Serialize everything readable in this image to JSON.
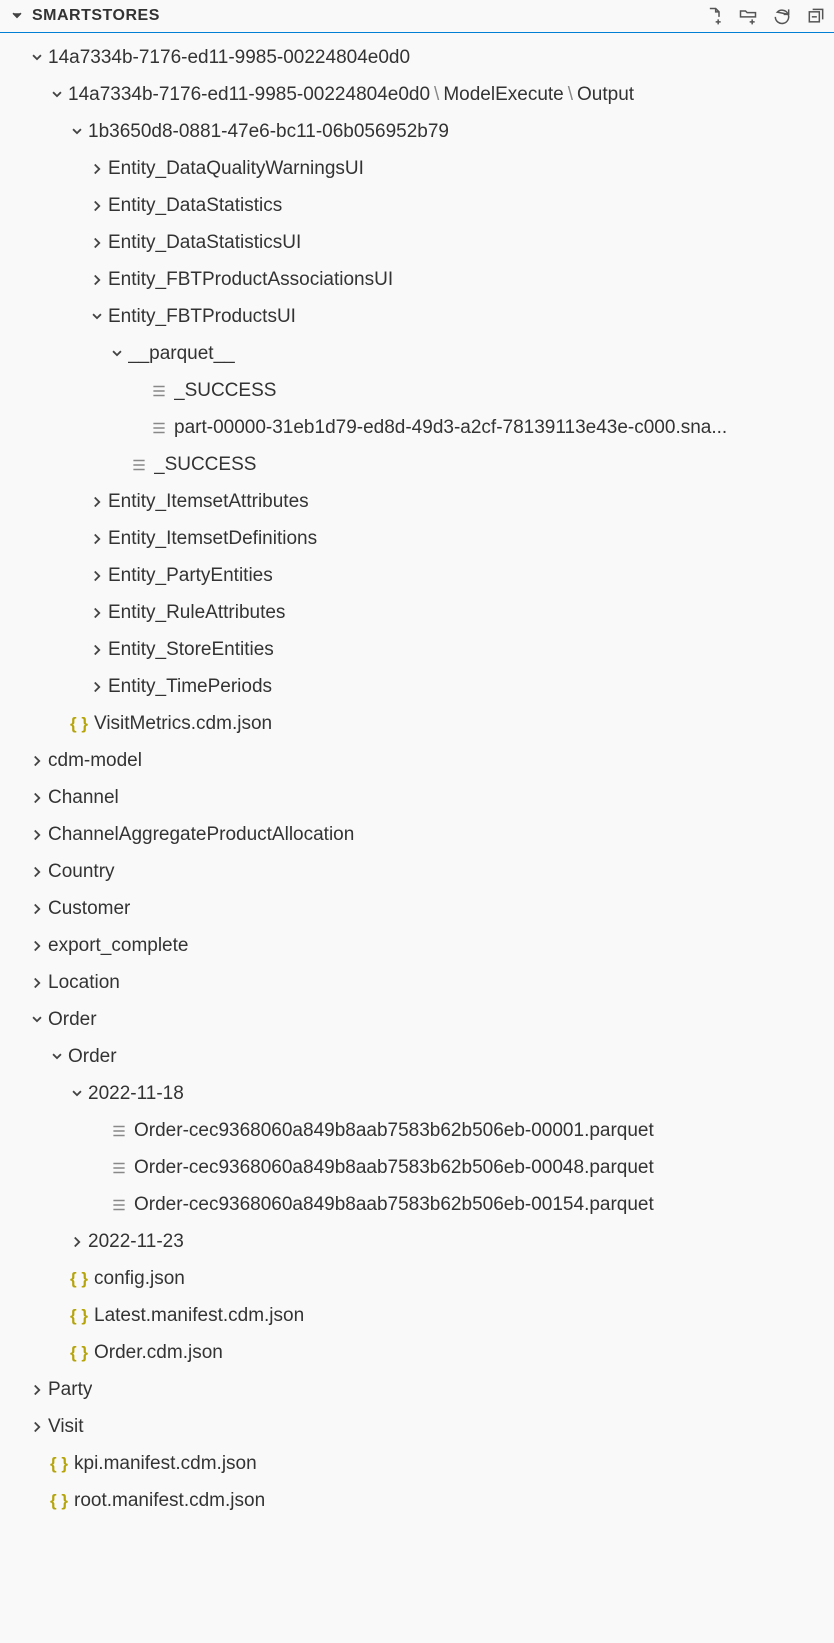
{
  "header": {
    "title": "SMARTSTORES"
  },
  "tree": [
    {
      "indent": 1,
      "twistie": "down",
      "icon": "",
      "label": "14a7334b-7176-ed11-9985-00224804e0d0",
      "pathSegments": null
    },
    {
      "indent": 2,
      "twistie": "down",
      "icon": "",
      "label": "",
      "pathSegments": [
        "14a7334b-7176-ed11-9985-00224804e0d0",
        "ModelExecute",
        "Output"
      ]
    },
    {
      "indent": 3,
      "twistie": "down",
      "icon": "",
      "label": "1b3650d8-0881-47e6-bc11-06b056952b79",
      "pathSegments": null
    },
    {
      "indent": 4,
      "twistie": "right",
      "icon": "",
      "label": "Entity_DataQualityWarningsUI",
      "pathSegments": null
    },
    {
      "indent": 4,
      "twistie": "right",
      "icon": "",
      "label": "Entity_DataStatistics",
      "pathSegments": null
    },
    {
      "indent": 4,
      "twistie": "right",
      "icon": "",
      "label": "Entity_DataStatisticsUI",
      "pathSegments": null
    },
    {
      "indent": 4,
      "twistie": "right",
      "icon": "",
      "label": "Entity_FBTProductAssociationsUI",
      "pathSegments": null
    },
    {
      "indent": 4,
      "twistie": "down",
      "icon": "",
      "label": "Entity_FBTProductsUI",
      "pathSegments": null
    },
    {
      "indent": 5,
      "twistie": "down",
      "icon": "",
      "label": "__parquet__",
      "pathSegments": null
    },
    {
      "indent": 6,
      "twistie": "none",
      "icon": "file",
      "label": "_SUCCESS",
      "pathSegments": null
    },
    {
      "indent": 6,
      "twistie": "none",
      "icon": "file",
      "label": "part-00000-31eb1d79-ed8d-49d3-a2cf-78139113e43e-c000.sna...",
      "pathSegments": null
    },
    {
      "indent": 5,
      "twistie": "none",
      "icon": "file",
      "label": "_SUCCESS",
      "pathSegments": null
    },
    {
      "indent": 4,
      "twistie": "right",
      "icon": "",
      "label": "Entity_ItemsetAttributes",
      "pathSegments": null
    },
    {
      "indent": 4,
      "twistie": "right",
      "icon": "",
      "label": "Entity_ItemsetDefinitions",
      "pathSegments": null
    },
    {
      "indent": 4,
      "twistie": "right",
      "icon": "",
      "label": "Entity_PartyEntities",
      "pathSegments": null
    },
    {
      "indent": 4,
      "twistie": "right",
      "icon": "",
      "label": "Entity_RuleAttributes",
      "pathSegments": null
    },
    {
      "indent": 4,
      "twistie": "right",
      "icon": "",
      "label": "Entity_StoreEntities",
      "pathSegments": null
    },
    {
      "indent": 4,
      "twistie": "right",
      "icon": "",
      "label": "Entity_TimePeriods",
      "pathSegments": null
    },
    {
      "indent": 2,
      "twistie": "none",
      "icon": "json",
      "label": "VisitMetrics.cdm.json",
      "pathSegments": null
    },
    {
      "indent": 1,
      "twistie": "right",
      "icon": "",
      "label": "cdm-model",
      "pathSegments": null
    },
    {
      "indent": 1,
      "twistie": "right",
      "icon": "",
      "label": "Channel",
      "pathSegments": null
    },
    {
      "indent": 1,
      "twistie": "right",
      "icon": "",
      "label": "ChannelAggregateProductAllocation",
      "pathSegments": null
    },
    {
      "indent": 1,
      "twistie": "right",
      "icon": "",
      "label": "Country",
      "pathSegments": null
    },
    {
      "indent": 1,
      "twistie": "right",
      "icon": "",
      "label": "Customer",
      "pathSegments": null
    },
    {
      "indent": 1,
      "twistie": "right",
      "icon": "",
      "label": "export_complete",
      "pathSegments": null
    },
    {
      "indent": 1,
      "twistie": "right",
      "icon": "",
      "label": "Location",
      "pathSegments": null
    },
    {
      "indent": 1,
      "twistie": "down",
      "icon": "",
      "label": "Order",
      "pathSegments": null
    },
    {
      "indent": 2,
      "twistie": "down",
      "icon": "",
      "label": "Order",
      "pathSegments": null
    },
    {
      "indent": 3,
      "twistie": "down",
      "icon": "",
      "label": "2022-11-18",
      "pathSegments": null
    },
    {
      "indent": 4,
      "twistie": "none",
      "icon": "file",
      "label": "Order-cec9368060a849b8aab7583b62b506eb-00001.parquet",
      "pathSegments": null
    },
    {
      "indent": 4,
      "twistie": "none",
      "icon": "file",
      "label": "Order-cec9368060a849b8aab7583b62b506eb-00048.parquet",
      "pathSegments": null
    },
    {
      "indent": 4,
      "twistie": "none",
      "icon": "file",
      "label": "Order-cec9368060a849b8aab7583b62b506eb-00154.parquet",
      "pathSegments": null
    },
    {
      "indent": 3,
      "twistie": "right",
      "icon": "",
      "label": "2022-11-23",
      "pathSegments": null
    },
    {
      "indent": 2,
      "twistie": "none",
      "icon": "json",
      "label": "config.json",
      "pathSegments": null
    },
    {
      "indent": 2,
      "twistie": "none",
      "icon": "json",
      "label": "Latest.manifest.cdm.json",
      "pathSegments": null
    },
    {
      "indent": 2,
      "twistie": "none",
      "icon": "json",
      "label": "Order.cdm.json",
      "pathSegments": null
    },
    {
      "indent": 1,
      "twistie": "right",
      "icon": "",
      "label": "Party",
      "pathSegments": null
    },
    {
      "indent": 1,
      "twistie": "right",
      "icon": "",
      "label": "Visit",
      "pathSegments": null
    },
    {
      "indent": 1,
      "twistie": "none",
      "icon": "json",
      "label": "kpi.manifest.cdm.json",
      "pathSegments": null
    },
    {
      "indent": 1,
      "twistie": "none",
      "icon": "json",
      "label": "root.manifest.cdm.json",
      "pathSegments": null
    }
  ]
}
